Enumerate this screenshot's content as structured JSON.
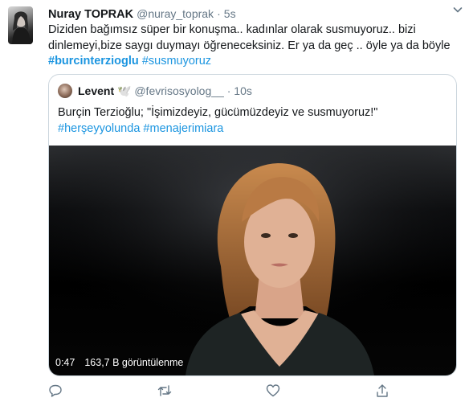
{
  "tweet": {
    "author_name": "Nuray TOPRAK",
    "author_handle": "@nuray_toprak",
    "separator": "·",
    "time": "5s",
    "text_plain": "Diziden bağımsız süper bir konuşma.. kadınlar olarak susmuyoruz.. bizi dinlemeyi,bize saygı duymayı öğreneceksiniz. Er ya da geç .. öyle ya da böyle",
    "hashtag_1": "#burcinterzioglu",
    "hashtag_2": "#susmuyoruz"
  },
  "quoted_tweet": {
    "author_name": "Levent",
    "author_emoji": "🕊️",
    "author_handle": "@fevrisosyolog__",
    "separator": "·",
    "time": "10s",
    "text_line": "Burçin Terzioğlu; \"İşimizdeyiz, gücümüzdeyiz ve susmuyoruz!\"",
    "hashtag_1": "#herşeyyolunda",
    "hashtag_2": "#menajerimiara"
  },
  "video": {
    "duration": "0:47",
    "views": "163,7 B görüntülenme"
  },
  "actions": {
    "reply": "reply-icon",
    "retweet": "retweet-icon",
    "like": "heart-icon",
    "share": "share-icon"
  },
  "colors": {
    "link": "#1b95e0",
    "muted": "#657786",
    "icon": "#657786",
    "border": "#ccd6dd"
  }
}
